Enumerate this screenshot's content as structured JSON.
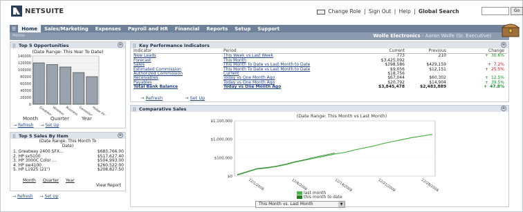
{
  "app": {
    "name": "NETSUITE"
  },
  "toplinks": {
    "change_role": "Change Role",
    "sign_out": "Sign Out",
    "help": "Help",
    "global_search": "Global Search",
    "go": "Go"
  },
  "nav": {
    "tabs": [
      "Home",
      "Sales/Marketing",
      "Expenses",
      "Payroll and HR",
      "Financial",
      "Reports",
      "Setup",
      "Support"
    ],
    "active": "Home",
    "sub_home": "Home",
    "company": "Wolfe Electronics",
    "user": "- Aaron Wolfe (Sr. Executive)"
  },
  "opportunities": {
    "title": "Top 5 Opportunities",
    "range": "(Date Range: This Year To Date)",
    "periods": [
      "Month",
      "Quarter",
      "Year"
    ],
    "refresh": "Refresh",
    "setup": "Set Up"
  },
  "sales_by_item": {
    "title": "Top 5 Sales By Item",
    "range_line1": "(Date Range: This Month To",
    "range_line2": "Date)",
    "rows": [
      {
        "item": "1. Greatway 2400 SFX...",
        "value": "$683,766.00"
      },
      {
        "item": "2. HP sx5100",
        "value": "$517,627.40"
      },
      {
        "item": "3. HP 3000C Color ...",
        "value": "$504,993.00"
      },
      {
        "item": "4. HP sw4100",
        "value": "$260,522.00"
      },
      {
        "item": "5. HP L1925 (21\")",
        "value": "$208,827.50"
      }
    ],
    "periods": [
      "Month",
      "Quarter",
      "Year"
    ],
    "view_report": "View Report",
    "refresh": "Refresh",
    "setup": "Set Up"
  },
  "kpi": {
    "title": "Key Performance Indicators",
    "headers": [
      "Indicator",
      "Period",
      "Current",
      "Previous",
      "Change"
    ],
    "rows": [
      {
        "indicator": "New Leads",
        "period": "This Week vs Last Week",
        "current": "773",
        "previous": "210",
        "dir": "+",
        "change": "30.6%",
        "cls": "up"
      },
      {
        "indicator": "Forecast",
        "period": "This Month",
        "current": "$3,425,092",
        "previous": "",
        "dir": "",
        "change": "",
        "cls": ""
      },
      {
        "indicator": "Sales",
        "period": "This Month To Date vs Last Month to Date",
        "current": "$398,586",
        "previous": "$429,159",
        "dir": "+",
        "change": "7.2%",
        "cls": "down"
      },
      {
        "indicator": "Estimated Commission",
        "period": "This Month To Date vs Last Month to Date",
        "current": "$9,056",
        "previous": "$12,151",
        "dir": "+",
        "change": "25.5%",
        "cls": "down"
      },
      {
        "indicator": "Authorized Commission",
        "period": "Current",
        "current": "$18,756",
        "previous": "",
        "dir": "",
        "change": "",
        "cls": ""
      },
      {
        "indicator": "Receivables",
        "period": "Today vs One Month Ago",
        "current": "$67,044",
        "previous": "$60,302",
        "dir": "+",
        "change": "12.5%",
        "cls": "up"
      },
      {
        "indicator": "Payables",
        "period": "Today vs One Month Ago",
        "current": "$20,792",
        "previous": "$14,904",
        "dir": "+",
        "change": "39.5%",
        "cls": "up"
      },
      {
        "indicator": "Total Bank Balance",
        "period": "Today vs One Month Ago",
        "current": "$3,845,478",
        "previous": "$2,483,889",
        "dir": "+",
        "change": "47.8%",
        "cls": "up"
      }
    ],
    "refresh": "Refresh",
    "setup": "Set Up"
  },
  "comparative": {
    "title": "Comparative Sales",
    "select_value": "This Month vs. Last Month"
  },
  "chart_data": [
    {
      "type": "bar",
      "title": "Top 5 Opportunities",
      "categories": [
        "Greatway",
        "Wireless",
        "Business",
        "Gamestop",
        "Huber Pharma"
      ],
      "values": [
        120000,
        115000,
        108000,
        92000,
        80000
      ],
      "ylim": [
        0,
        140000
      ],
      "yticks": [
        "140000",
        "120000",
        "100000",
        "80000",
        "60000",
        "40000",
        "20000",
        "0"
      ]
    },
    {
      "type": "line",
      "title": "(Date Range: This Month vs Last Month)",
      "x": [
        "12/1/2008",
        "12/8/2008",
        "12/14/2008",
        "12/21/2008",
        "12/28/2008"
      ],
      "yticks": [
        "$1,100,000",
        "$1,000,000",
        "$100,000",
        "$0"
      ],
      "series": [
        {
          "name": "last month",
          "values": [
            20000,
            80000,
            140000,
            160000,
            190000,
            230000,
            280000,
            320000,
            360000,
            400000,
            440000,
            470000,
            520000,
            560000,
            600000,
            650000,
            690000,
            730000,
            770000,
            800000,
            830000
          ]
        },
        {
          "name": "this month to date",
          "values": [
            30000,
            90000,
            150000,
            170000,
            200000,
            240000,
            290000,
            330000,
            380000,
            420000,
            460000
          ]
        }
      ],
      "ylim": [
        0,
        1100000
      ],
      "legend": "bottom-center",
      "colors": {
        "last_month": "#4ab34a",
        "this_month": "#2a7a2a"
      }
    }
  ]
}
